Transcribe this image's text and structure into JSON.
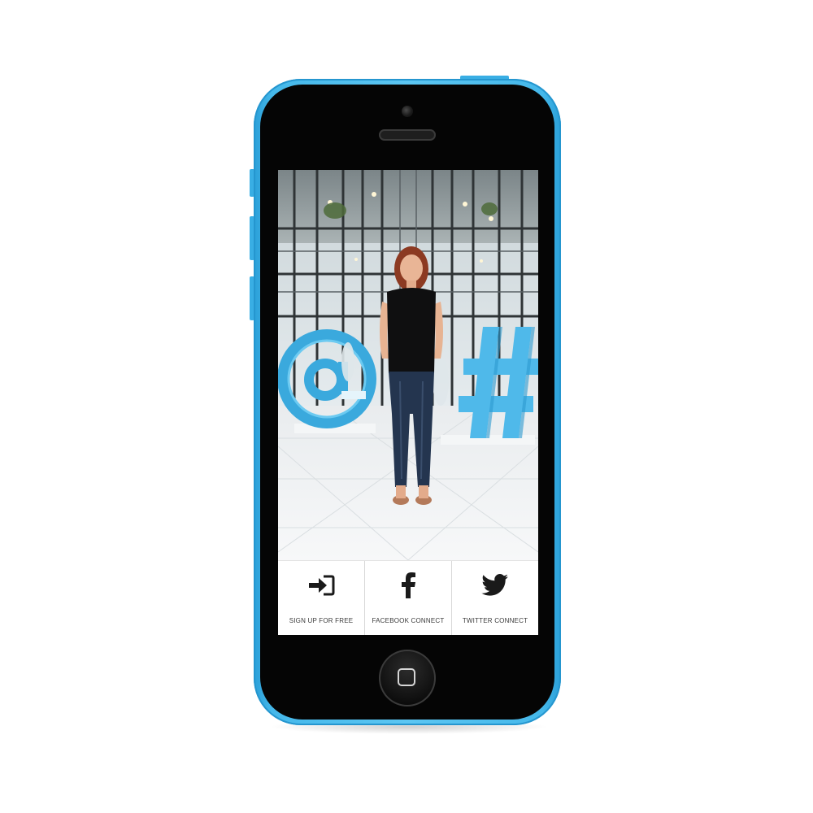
{
  "actions": [
    {
      "id": "signup",
      "label": "SIGN UP FOR FREE",
      "icon": "sign-in-icon"
    },
    {
      "id": "facebook",
      "label": "FACEBOOK CONNECT",
      "icon": "facebook-icon"
    },
    {
      "id": "twitter",
      "label": "TWITTER CONNECT",
      "icon": "twitter-icon"
    }
  ],
  "colors": {
    "phone_body": "#5cc6f2",
    "phone_front": "#050505",
    "accent_symbols": "#4fb9ea",
    "label_text": "#3a3a3a",
    "icon": "#1a1a1a"
  }
}
